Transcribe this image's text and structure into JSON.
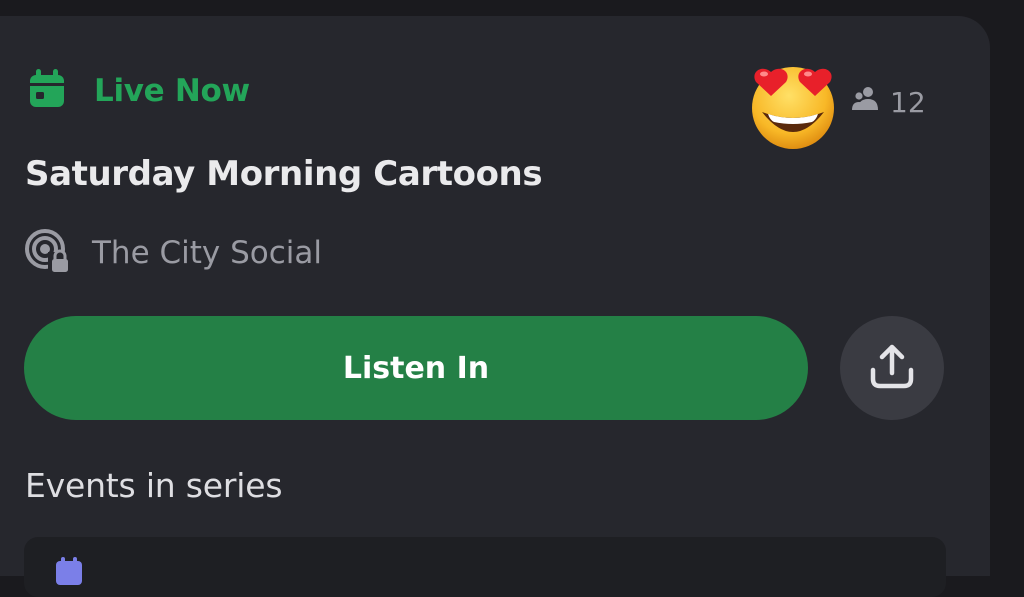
{
  "event": {
    "status": "Live Now",
    "title": "Saturday Morning Cartoons",
    "location": "The City Social",
    "attendee_count": "12",
    "reaction_emoji": "smiling-face-with-heart-eyes"
  },
  "actions": {
    "listen_label": "Listen In",
    "share_icon": "share-icon"
  },
  "series": {
    "heading": "Events in series"
  },
  "colors": {
    "live_green": "#23a559",
    "button_green": "#248046",
    "card_bg": "#26272d",
    "muted_text": "#9a9ba3"
  }
}
